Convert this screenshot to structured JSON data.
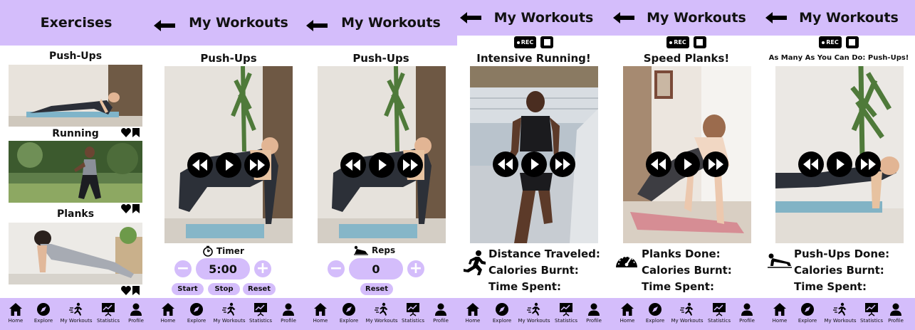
{
  "colors": {
    "accent": "#d4bdfb",
    "dark": "#000000",
    "background": "#ffffff"
  },
  "nav": {
    "items": [
      {
        "label": "Home",
        "icon": "home-icon"
      },
      {
        "label": "Explore",
        "icon": "compass-icon"
      },
      {
        "label": "My Workouts",
        "icon": "running-icon"
      },
      {
        "label": "Statistics",
        "icon": "chart-icon"
      },
      {
        "label": "Profile",
        "icon": "profile-icon"
      }
    ]
  },
  "screen1": {
    "title": "Exercises",
    "items": [
      {
        "label": "Push-Ups"
      },
      {
        "label": "Running"
      },
      {
        "label": "Planks"
      }
    ]
  },
  "screen2": {
    "title": "My Workouts",
    "exercise": "Push-Ups",
    "mode_label": "Timer",
    "value": "5:00",
    "minus": "−",
    "plus": "+",
    "start": "Start",
    "stop": "Stop",
    "reset": "Reset"
  },
  "screen3": {
    "title": "My Workouts",
    "exercise": "Push-Ups",
    "mode_label": "Reps",
    "value": "0",
    "minus": "−",
    "plus": "+",
    "reset": "Reset"
  },
  "screen4": {
    "title": "My Workouts",
    "rec": "REC",
    "video_title": "Intensive Running!",
    "stats": [
      "Distance Traveled:",
      "Calories Burnt:",
      "Time Spent:"
    ]
  },
  "screen5": {
    "title": "My Workouts",
    "rec": "REC",
    "video_title": "Speed Planks!",
    "stats": [
      "Planks Done:",
      "Calories Burnt:",
      "Time Spent:"
    ]
  },
  "screen6": {
    "title": "My Workouts",
    "rec": "REC",
    "video_title": "As Many As You Can Do: Push-Ups!",
    "stats": [
      "Push-Ups Done:",
      "Calories Burnt:",
      "Time Spent:"
    ]
  }
}
